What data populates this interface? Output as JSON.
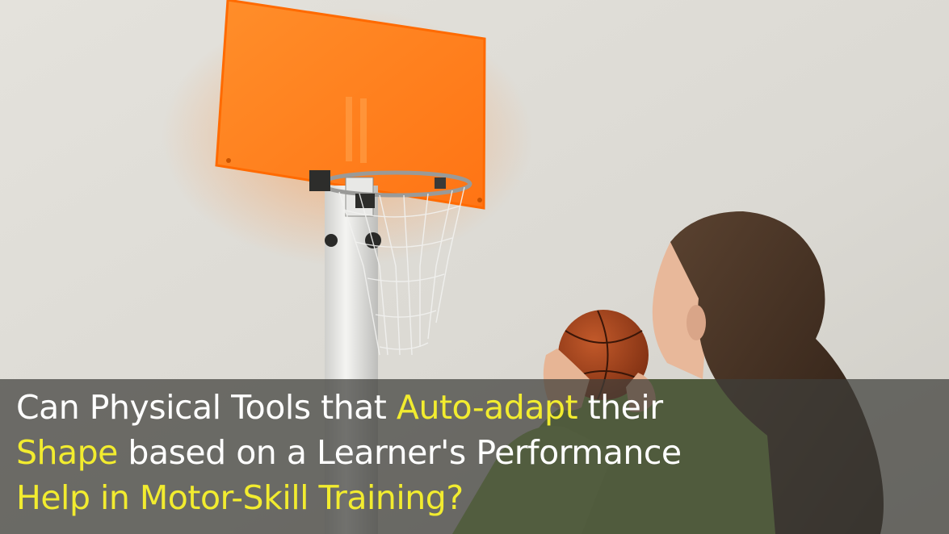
{
  "caption": {
    "line1": {
      "part1": "Can Physical Tools that ",
      "highlight": "Auto-adapt",
      "part2": " their"
    },
    "line2": {
      "highlight": "Shape",
      "part2": " based on a Learner's Performance"
    },
    "line3": {
      "highlight": "Help in Motor-Skill Training?"
    }
  },
  "colors": {
    "caption_text": "#ffffff",
    "caption_highlight": "#f2ec2f",
    "backboard": "#ff7a1a",
    "wall": "#dedcd6",
    "jacket": "#7fa645",
    "hair": "#3b2a1e",
    "ball": "#a8461c"
  }
}
